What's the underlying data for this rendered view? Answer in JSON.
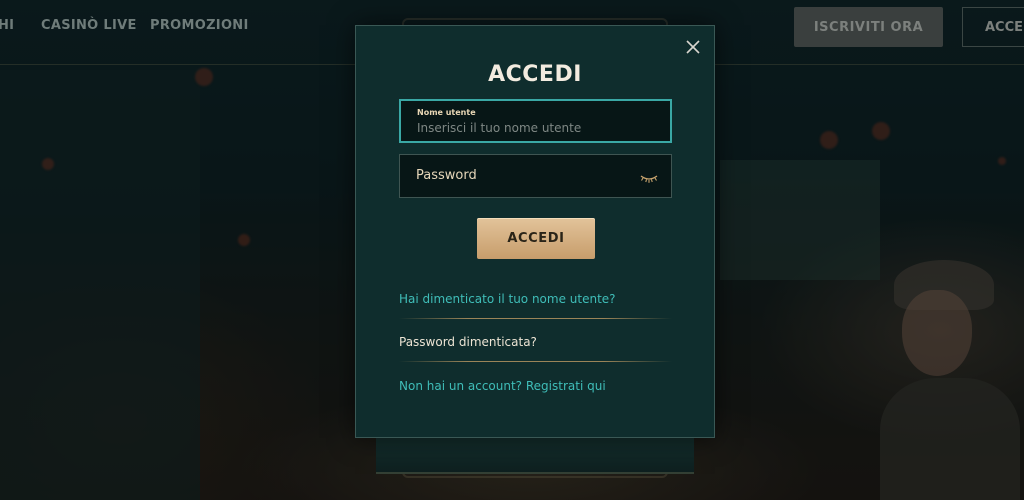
{
  "nav": {
    "items": [
      {
        "label": "HI"
      },
      {
        "label": "CASINÒ LIVE"
      },
      {
        "label": "PROMOZIONI"
      }
    ],
    "signup_label": "ISCRIVITI ORA",
    "login_label": "ACCEDI"
  },
  "modal": {
    "title": "ACCEDI",
    "close_icon": "close-icon",
    "username": {
      "label": "Nome utente",
      "placeholder": "Inserisci il tuo nome utente",
      "value": ""
    },
    "password": {
      "label": "Password",
      "toggle_icon": "eye-closed-icon"
    },
    "submit_label": "ACCEDI",
    "links": {
      "forgot_username": "Hai dimenticato il tuo nome utente?",
      "forgot_password": "Password dimenticata?",
      "register": "Non hai un account? Registrati qui"
    }
  },
  "colors": {
    "modal_bg": "#0f2d2d",
    "accent_teal": "#3fbdb8",
    "button_gold": "#d3ad7f",
    "title_text": "#f3ece0"
  }
}
